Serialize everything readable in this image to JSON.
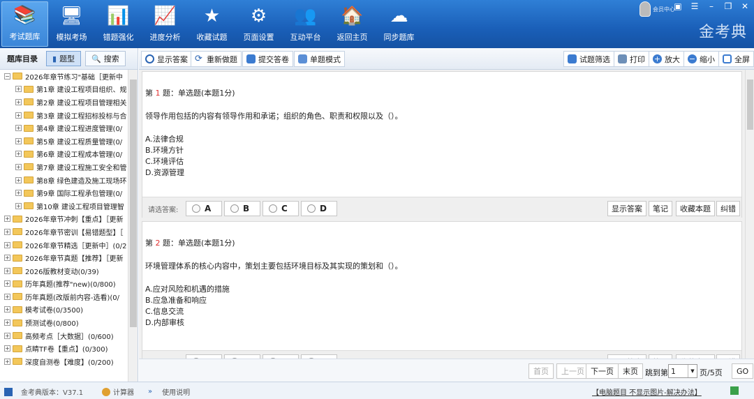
{
  "nav": [
    {
      "label": "考试题库",
      "icon": "books-icon",
      "glyph": "📚",
      "active": true
    },
    {
      "label": "模拟考场",
      "icon": "monitor-icon",
      "glyph": "🖥",
      "active": false
    },
    {
      "label": "错题强化",
      "icon": "bar-chart-icon",
      "glyph": "📊",
      "active": false
    },
    {
      "label": "进度分析",
      "icon": "chart-board-icon",
      "glyph": "📈",
      "active": false
    },
    {
      "label": "收藏试题",
      "icon": "star-icon",
      "glyph": "★",
      "active": false
    },
    {
      "label": "页面设置",
      "icon": "gear-icon",
      "glyph": "⚙",
      "active": false
    },
    {
      "label": "互动平台",
      "icon": "people-icon",
      "glyph": "👥",
      "active": false
    },
    {
      "label": "返回主页",
      "icon": "home-icon",
      "glyph": "🏠",
      "active": false
    },
    {
      "label": "同步题库",
      "icon": "sync-cloud-icon",
      "glyph": "☁",
      "active": false
    }
  ],
  "header": {
    "member_label": "会员中心",
    "brand": "金考典"
  },
  "left": {
    "title": "题库目录",
    "tab_type": "题型",
    "tab_search": "搜索",
    "tree": [
      {
        "level": 0,
        "pm": "−",
        "label": "2026年章节练习\"基础［更新中"
      },
      {
        "level": 1,
        "pm": "+",
        "label": "第1章 建设工程项目组织、规"
      },
      {
        "level": 1,
        "pm": "+",
        "label": "第2章 建设工程项目管理相关"
      },
      {
        "level": 1,
        "pm": "+",
        "label": "第3章 建设工程招标投标与合"
      },
      {
        "level": 1,
        "pm": "+",
        "label": "第4章 建设工程进度管理(0/"
      },
      {
        "level": 1,
        "pm": "+",
        "label": "第5章 建设工程质量管理(0/"
      },
      {
        "level": 1,
        "pm": "+",
        "label": "第6章 建设工程成本管理(0/"
      },
      {
        "level": 1,
        "pm": "+",
        "label": "第7章 建设工程施工安全和管"
      },
      {
        "level": 1,
        "pm": "+",
        "label": "第8章 绿色建造及施工现场环"
      },
      {
        "level": 1,
        "pm": "+",
        "label": "第9章 国际工程承包管理(0/"
      },
      {
        "level": 1,
        "pm": "+",
        "label": "第10章 建设工程项目管理智"
      },
      {
        "level": 0,
        "pm": "+",
        "label": "2026年章节冲刺【重点】［更新"
      },
      {
        "level": 0,
        "pm": "+",
        "label": "2026年章节密训【易错题型】［"
      },
      {
        "level": 0,
        "pm": "+",
        "label": "2026年章节精选［更新中］(0/21"
      },
      {
        "level": 0,
        "pm": "+",
        "label": "2026年章节真题【推荐】［更新"
      },
      {
        "level": 0,
        "pm": "+",
        "label": "2026版教材变动(0/39)"
      },
      {
        "level": 0,
        "pm": "+",
        "label": "历年真题(推荐\"new)(0/800)"
      },
      {
        "level": 0,
        "pm": "+",
        "label": "历年真题(改版前内容-选看)(0/"
      },
      {
        "level": 0,
        "pm": "+",
        "label": "模考试卷(0/3500)"
      },
      {
        "level": 0,
        "pm": "+",
        "label": "预测试卷(0/800)"
      },
      {
        "level": 0,
        "pm": "+",
        "label": "高频考点［大数据］(0/600)"
      },
      {
        "level": 0,
        "pm": "+",
        "label": "点睛TF卷【重点】(0/300)"
      },
      {
        "level": 0,
        "pm": "+",
        "label": "深度自测卷【难度】(0/200)"
      }
    ]
  },
  "toolbar": {
    "show_answer": "显示答案",
    "redo": "重新做题",
    "submit": "提交答卷",
    "single_mode": "单题模式",
    "filter": "试题筛选",
    "print": "打印",
    "zoom_in": "放大",
    "zoom_out": "缩小",
    "fullscreen": "全屏"
  },
  "questions": [
    {
      "prefix": "第",
      "num": "1",
      "suffix": "题：单选题(本题1分)",
      "stem": "领导作用包括的内容有领导作用和承诺；组织的角色、职责和权限以及（）。",
      "options": [
        "A.法律合规",
        "B.环境方针",
        "C.环境评估",
        "D.资源管理"
      ]
    },
    {
      "prefix": "第",
      "num": "2",
      "suffix": "题：单选题(本题1分)",
      "stem": "环境管理体系的核心内容中，策划主要包括环境目标及其实现的策划和（）。",
      "options": [
        "A.应对风险和机遇的措施",
        "B.应急准备和响应",
        "C.信息交流",
        "D.内部审核"
      ]
    }
  ],
  "answer_bar": {
    "label": "请选答案:",
    "choices": [
      "A",
      "B",
      "C",
      "D"
    ],
    "show_answer": "显示答案",
    "note": "笔记",
    "favorite": "收藏本题",
    "correct": "纠错"
  },
  "pager": {
    "first": "首页",
    "prev": "上一页",
    "next": "下一页",
    "last": "末页",
    "jump_label": "跳到第",
    "page_value": "1",
    "page_total": "页/5页",
    "go": "GO"
  },
  "status": {
    "version": "金考典版本：V37.1",
    "calculator": "计算器",
    "manual": "使用说明",
    "image_help": "【电脑题目 不显示图片-解决办法】"
  },
  "colors": {
    "accent": "#1a5fb8",
    "question_number": "#e03030"
  }
}
